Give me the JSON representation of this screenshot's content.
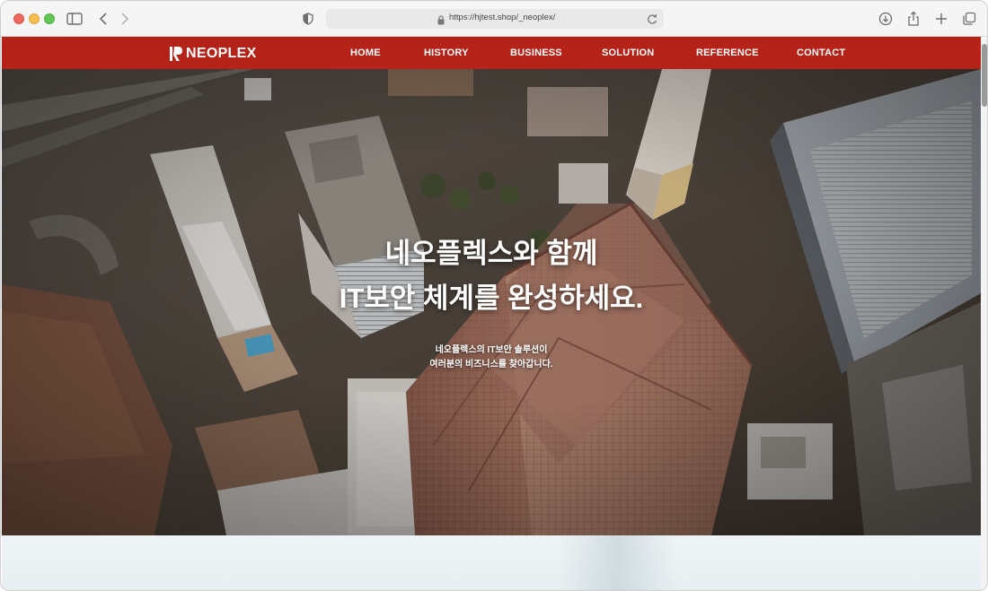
{
  "browser": {
    "url": "https://hjtest.shop/_neoplex/",
    "icons": [
      "sidebar-icon",
      "back-icon",
      "forward-icon",
      "shield-icon",
      "lock-icon",
      "reload-icon",
      "download-icon",
      "share-icon",
      "new-tab-icon",
      "tabs-overview-icon"
    ]
  },
  "site": {
    "logo_text": "NEOPLEX",
    "nav": {
      "home": "HOME",
      "history": "HISTORY",
      "business": "BUSINESS",
      "solution": "SOLUTION",
      "reference": "REFERENCE",
      "contact": "CONTACT"
    },
    "hero": {
      "title_line1": "네오플렉스와 함께",
      "title_line2": "IT보안 체계를 완성하세요.",
      "sub_line1": "네오플렉스의 IT보안 솔루션이",
      "sub_line2": "여러분의 비즈니스를 찾아갑니다."
    }
  },
  "colors": {
    "brand_red": "#b52218",
    "hero_text": "#ffffff"
  }
}
